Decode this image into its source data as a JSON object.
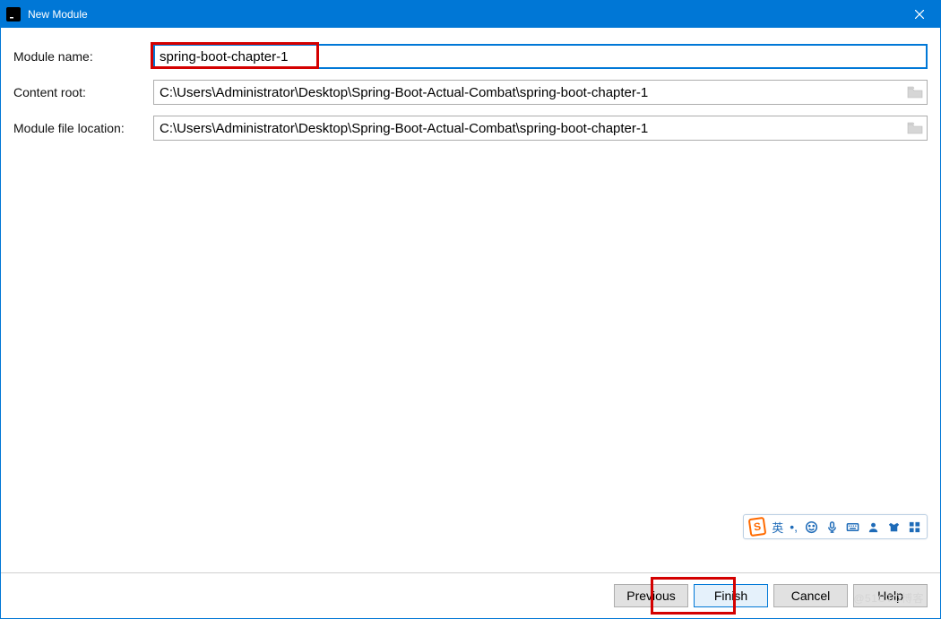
{
  "window": {
    "title": "New Module"
  },
  "form": {
    "module_name_label": "Module name:",
    "module_name_value": "spring-boot-chapter-1",
    "content_root_label": "Content root:",
    "content_root_value": "C:\\Users\\Administrator\\Desktop\\Spring-Boot-Actual-Combat\\spring-boot-chapter-1",
    "module_file_label": "Module file location:",
    "module_file_value": "C:\\Users\\Administrator\\Desktop\\Spring-Boot-Actual-Combat\\spring-boot-chapter-1"
  },
  "buttons": {
    "previous": "Previous",
    "finish": "Finish",
    "cancel": "Cancel",
    "help": "Help"
  },
  "ime": {
    "logo_letter": "S",
    "lang": "英",
    "punct": "•,"
  },
  "watermark": "@51CTO博客"
}
